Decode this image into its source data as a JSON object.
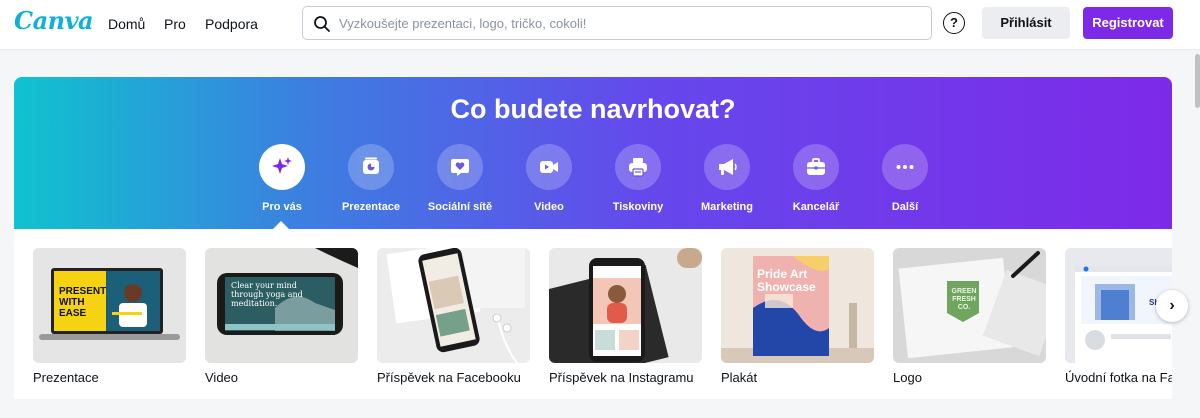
{
  "header": {
    "logo": "Canva",
    "nav": [
      "Domů",
      "Pro",
      "Podpora"
    ],
    "search_placeholder": "Vyzkoušejte prezentaci, logo, tričko, cokoli!",
    "help": "?",
    "login": "Přihlásit",
    "register": "Registrovat"
  },
  "hero": {
    "title": "Co budete navrhovat?",
    "categories": [
      {
        "label": "Pro vás",
        "icon": "sparkles-icon",
        "active": true
      },
      {
        "label": "Prezentace",
        "icon": "presentation-icon",
        "active": false
      },
      {
        "label": "Sociální sítě",
        "icon": "heart-chat-icon",
        "active": false
      },
      {
        "label": "Video",
        "icon": "video-camera-icon",
        "active": false
      },
      {
        "label": "Tiskoviny",
        "icon": "printer-icon",
        "active": false
      },
      {
        "label": "Marketing",
        "icon": "megaphone-icon",
        "active": false
      },
      {
        "label": "Kancelář",
        "icon": "briefcase-icon",
        "active": false
      },
      {
        "label": "Další",
        "icon": "more-dots-icon",
        "active": false
      }
    ]
  },
  "templates": [
    {
      "label": "Prezentace",
      "thumb_text": "PRESENT WITH EASE"
    },
    {
      "label": "Video",
      "thumb_text": "Clear your mind through yoga and meditation."
    },
    {
      "label": "Příspěvek na Facebooku"
    },
    {
      "label": "Příspěvek na Instagramu"
    },
    {
      "label": "Plakát",
      "thumb_text": "Pride Art Showcase"
    },
    {
      "label": "Logo",
      "thumb_text": "GREEN FRESH CO."
    },
    {
      "label": "Úvodní fotka na Facebook",
      "thumb_text": "Shopping"
    }
  ],
  "colors": {
    "brand": "#11b0d8",
    "accent": "#7d2ae8",
    "hero_gradient": [
      "#0fc3cf",
      "#3c7fe0",
      "#6548ec",
      "#7d2ae8"
    ]
  }
}
